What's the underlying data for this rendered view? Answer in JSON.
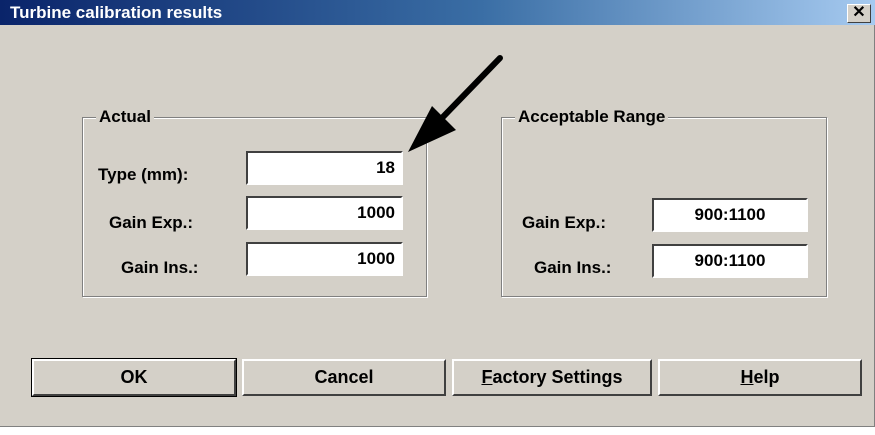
{
  "window": {
    "title": "Turbine calibration results",
    "close_glyph": "✕"
  },
  "actual": {
    "group_label": "Actual",
    "type_label": "Type (mm):",
    "type_value": "18",
    "gain_exp_label": "Gain Exp.:",
    "gain_exp_value": "1000",
    "gain_ins_label": "Gain Ins.:",
    "gain_ins_value": "1000"
  },
  "range": {
    "group_label": "Acceptable Range",
    "gain_exp_label": "Gain Exp.:",
    "gain_exp_value": "900:1100",
    "gain_ins_label": "Gain Ins.:",
    "gain_ins_value": "900:1100"
  },
  "buttons": {
    "ok": "OK",
    "cancel": "Cancel",
    "factory_first": "F",
    "factory_rest": "actory Settings",
    "help_first": "H",
    "help_rest": "elp"
  },
  "annotation": {
    "arrow_icon": "black-arrow-icon",
    "arrow_color": "#000000"
  }
}
